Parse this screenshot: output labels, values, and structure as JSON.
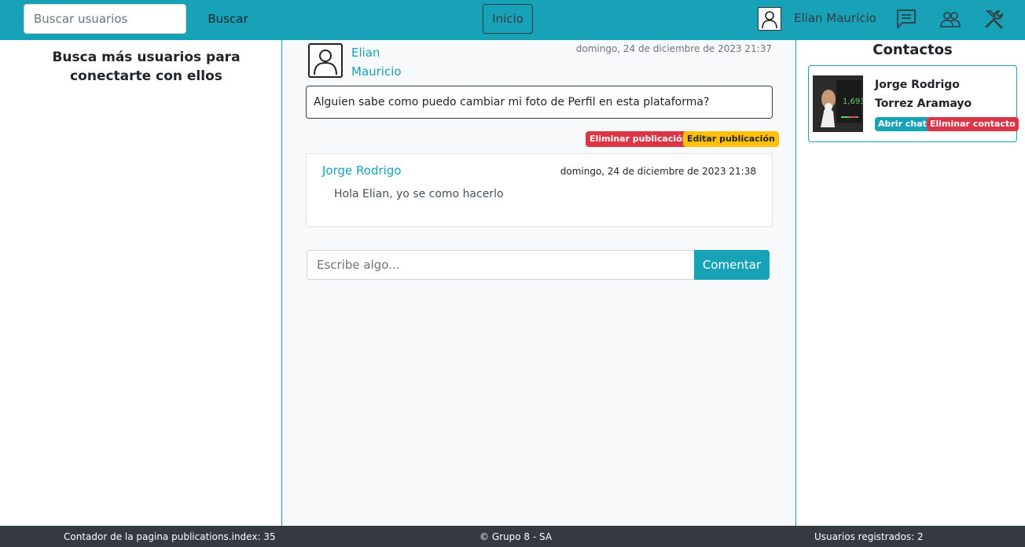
{
  "navbar": {
    "search_placeholder": "Buscar usuarios",
    "search_button": "Buscar",
    "home_button": "Inicio",
    "user_name": "Elian Mauricio",
    "icons": [
      "chat-icon",
      "users-icon",
      "tools-icon"
    ],
    "background": "#17a2b8"
  },
  "left": {
    "title": "Busca más usuarios para conectarte con ellos"
  },
  "post": {
    "author_first": "Elian",
    "author_last": "Mauricio",
    "date": "domingo, 24 de diciembre de 2023 21:37",
    "body": "Alguien sabe como puedo cambiar mi foto de Perfil en esta plataforma?",
    "delete_label": "Eliminar publicación",
    "edit_label": "Editar publicación"
  },
  "comment": {
    "author": "Jorge Rodrigo",
    "date": "domingo, 24 de diciembre de 2023 21:38",
    "text": "Hola Elian, yo se como hacerlo"
  },
  "comment_form": {
    "placeholder": "Escribe algo...",
    "button": "Comentar"
  },
  "contacts": {
    "title": "Contactos",
    "items": [
      {
        "first": "Jorge Rodrigo",
        "last": "Torrez Aramayo",
        "open_chat": "Abrir chat",
        "delete": "Eliminar contacto",
        "photo_text": "1,693"
      }
    ]
  },
  "footer": {
    "counter": "Contador de la pagina publications.index: 35",
    "copyright": "© Grupo 8 - SA",
    "registered": "Usuarios registrados: 2"
  },
  "colors": {
    "accent": "#17a2b8",
    "danger": "#dc3545",
    "warning": "#ffc107",
    "footer": "#343a40"
  }
}
